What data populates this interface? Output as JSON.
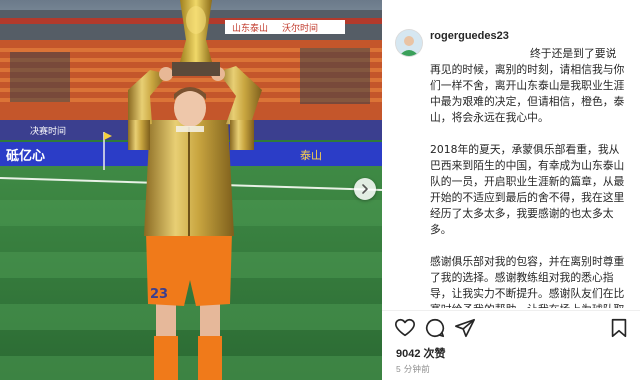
{
  "post": {
    "username": "rogerguedes23",
    "caption": [
      "终于还是到了要说再见的时候，离别的时刻，请相信我与你们一样不舍，离开山东泰山是我职业生涯中最为艰难的决定，但请相信，橙色，泰山，将会永远在我心中。",
      "2018年的夏天，承蒙俱乐部看重，我从巴西来到陌生的中国，有幸成为山东泰山队的一员，开启职业生涯新的篇章，从最开始的不适应到最后的舍不得，我在这里经历了太多太多，我要感谢的也太多太多。",
      "感谢俱乐部对我的包容，并在离别时尊重了我的选择。感谢教练组对我的悉心指导，让我实力不断提升。感谢队友们在比赛时给予我的帮助，让我在场上为球队取得进球。最该感谢的还是还是球迷们，你们是最伟大最可敬的人，希望你们可以继续支持我，支持山东泰山。"
    ],
    "likes": "9042 次赞",
    "time_ago": "5 分钟前"
  },
  "photo": {
    "stadium_banners": [
      "山东泰山",
      "沃尔时间",
      "决赛时间",
      "砥亿心",
      "泰山"
    ],
    "jersey_number": "23"
  },
  "icons": {
    "like": "heart-icon",
    "comment": "comment-icon",
    "share": "send-icon",
    "save": "bookmark-icon",
    "next": "chevron-right-icon"
  },
  "colors": {
    "text": "#262626",
    "muted": "#8e8e8e",
    "gold": "#c9a640",
    "orange": "#f07a1a"
  }
}
